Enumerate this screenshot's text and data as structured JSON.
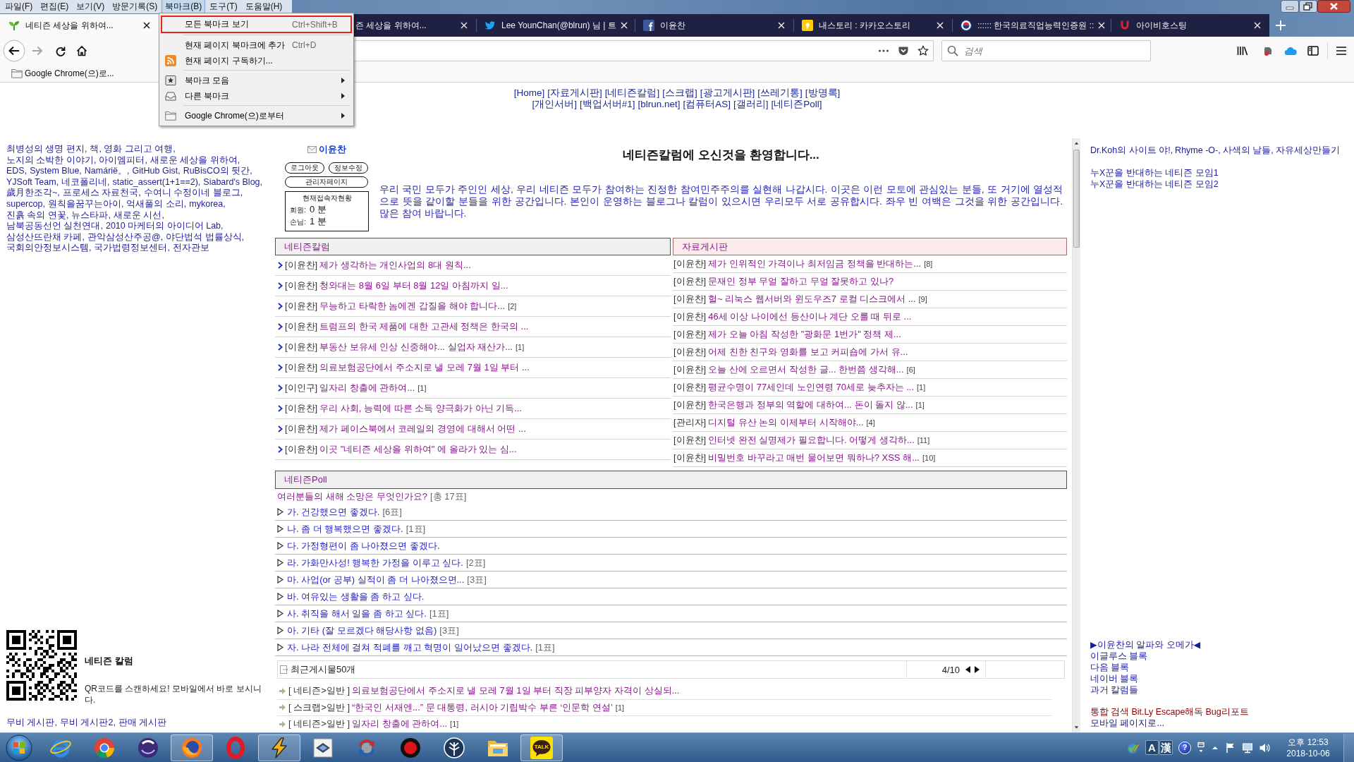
{
  "menu_bar": [
    {
      "label": "파일(F)",
      "selected": false
    },
    {
      "label": "편집(E)",
      "selected": false
    },
    {
      "label": "보기(V)",
      "selected": false
    },
    {
      "label": "방문기록(S)",
      "selected": false
    },
    {
      "label": "북마크(B)",
      "selected": true
    },
    {
      "label": "도구(T)",
      "selected": false
    },
    {
      "label": "도움말(H)",
      "selected": false
    }
  ],
  "tabs": [
    {
      "title": "네티즌 세상을 위하여...",
      "selected": true
    },
    {
      "title": "즌 세상을 위하여...",
      "selected": false
    },
    {
      "title": "Lee YounChan(@blrun) 님 | 트",
      "selected": false
    },
    {
      "title": "이윤찬",
      "selected": false
    },
    {
      "title": "내스토리 : 카카오스토리",
      "selected": false
    },
    {
      "title": ":::::: 한국의료직업능력인증원 ::",
      "selected": false
    },
    {
      "title": "아이비호스팅",
      "selected": false
    }
  ],
  "bookmarks_menu": [
    {
      "kind": "item",
      "label": "모든 북마크 보기",
      "shortcut": "Ctrl+Shift+B",
      "selected": true,
      "submenu": false
    },
    {
      "kind": "separator"
    },
    {
      "kind": "item",
      "label": "현재 페이지 북마크에 추가",
      "shortcut": "Ctrl+D",
      "selected": false,
      "submenu": false
    },
    {
      "kind": "item",
      "label": "현재 페이지 구독하기...",
      "selected": false,
      "submenu": false
    },
    {
      "kind": "separator"
    },
    {
      "kind": "item",
      "label": "북마크 모음",
      "selected": false,
      "submenu": true
    },
    {
      "kind": "item",
      "label": "다른 북마크",
      "selected": false,
      "submenu": true
    },
    {
      "kind": "separator"
    },
    {
      "kind": "item",
      "label": "Google Chrome(으)로부터",
      "selected": false,
      "submenu": true
    }
  ],
  "search": {
    "placeholder": "검색"
  },
  "bookmarks_toolbar": [
    "Google Chrome(으)로..."
  ],
  "page": {
    "top_link_rows": [
      [
        "[Home]",
        "[자료게시판]",
        "[네티즌칼럼]",
        "[스크랩]",
        "[광고게시판]",
        "[쓰레기통]",
        "[방명록]"
      ],
      [
        "[개인서버]",
        "[백업서버#1]",
        "[blrun.net]",
        "[컴퓨터AS]",
        "[갤러리]",
        "[네티즌Poll]"
      ]
    ],
    "left_sidebar": {
      "blog_links": [
        "최병성의 생명 편지,",
        "책, 영화 그리고 여행,",
        "노지의 소박한 이야기,",
        "아이엠피터,",
        "새로운 세상을 위하여,",
        "EDS,",
        "System Blue,",
        "Namárië。,",
        "GitHub Gist,",
        "RuBisCO의 뒷간,",
        "YJSoft Team,",
        "네코폴리네,",
        "static_assert(1+1==2),",
        "Siabard's Blog,",
        "歲月한조각~,",
        "프로세스 자료천국,",
        "수여니 수정이네 블로그,",
        "supercop,",
        "원칙을꿈꾸는아이,",
        "억새풀의 소리,",
        "mykorea,",
        "진흙 속의 연꽃,",
        "뉴스타파,",
        "새로운 시선,",
        "남북공동선언 실천연대,",
        "2010 마케터의 아이디어 Lab,",
        "삼성산뜨란채 카페,",
        "관악삼성산주공@,",
        "야단법석 법률상식,",
        "국회의안정보시스템,",
        "국가법령정보센터,",
        "전자관보"
      ],
      "qr_title": "네티즌 칼럼",
      "qr_caption": "QR코드를 스캔하세요! 모바일에서 바로 보시니다.",
      "board_links": [
        "무비 게시판,",
        "무비 게시판2,",
        "판매 게시판"
      ]
    },
    "user_panel": {
      "name": "이윤찬",
      "buttons": [
        "로그아웃",
        "정보수정",
        "관리자페이지"
      ],
      "visitors_title": "현재접속자현황",
      "visitors": [
        {
          "label": "회원:",
          "count": "0 분"
        },
        {
          "label": "손님:",
          "count": "1 분"
        }
      ]
    },
    "welcome": {
      "title": "네티즌칼럼에 오신것을 환영합니다...",
      "text": "우리 국민 모두가 주인인 세상, 우리 네티즌 모두가 참여하는 진정한 참여민주주의를 실현해 나갑시다. 이곳은 이런 모토에 관심있는 분들, 또 거기에 열성적으로 뜻을 같이할 분들을 위한 공간입니다. 본인이 운영하는 블로그나 칼럼이 있으시면 우리모두 서로 공유합시다. 좌우 빈 여백은 그것을 위한 공간입니다. 많은 참여 바랍니다."
    },
    "boards": [
      {
        "kind": "column",
        "title": "네티즌칼럼",
        "posts": [
          {
            "author": "[이윤찬]",
            "title": "제가 생각하는 개인사업의 8대 원칙..."
          },
          {
            "author": "[이윤찬]",
            "title": "청와대는 8월 6일 부터 8월 12일 아침까지 일..."
          },
          {
            "author": "[이윤찬]",
            "title": "무능하고 타락한 놈에겐 갑질을 해야 합니다...",
            "comments": "[2]"
          },
          {
            "author": "[이윤찬]",
            "title": "트럼프의 한국 제품에 대한 고관세 정책은 한국의 ..."
          },
          {
            "author": "[이윤찬]",
            "title": "부동산 보유세 인상 신중해야... 실업자 재산가...",
            "comments": "[1]"
          },
          {
            "author": "[이윤찬]",
            "title": "의료보험공단에서 주소지로 낼 모레 7월 1일 부터 ..."
          },
          {
            "author": "[이인구]",
            "title": "일자리 창출에 관하여...",
            "comments": "[1]"
          },
          {
            "author": "[이윤찬]",
            "title": "우리 사회, 능력에 따른 소득 양극화가 아닌 기득..."
          },
          {
            "author": "[이윤찬]",
            "title": "제가 페이스북에서 코레일의 경영에 대해서 어떤 ..."
          },
          {
            "author": "[이윤찬]",
            "title": "이곳 \"네티즌 세상을 위하여\" 에 올라가 있는 심..."
          }
        ]
      },
      {
        "kind": "archive",
        "title": "자료게시판",
        "posts": [
          {
            "author": "[이윤찬]",
            "title": "제가 인위적인 가격이나 최저임금 정책을 반대하는...",
            "comments": "[8]"
          },
          {
            "author": "[이윤찬]",
            "title": "문재인 정부 무얼 잘하고 무얼 잘못하고 있나?"
          },
          {
            "author": "[이윤찬]",
            "title": "헐~ 리눅스 웹서버와 윈도우즈7 로컬 디스크에서 ...",
            "comments": "[9]"
          },
          {
            "author": "[이윤찬]",
            "title": "46세 이상 나이에선 등산이나 계단 오를 때 뒤로 ..."
          },
          {
            "author": "[이윤찬]",
            "title": "제가 오늘 아침 작성한 \"광화문 1번가\" 정책 제..."
          },
          {
            "author": "[이윤찬]",
            "title": "어제 친한 친구와 영화를 보고 커피숍에 가서 유..."
          },
          {
            "author": "[이윤찬]",
            "title": "오늘 산에 오르면서 작성한 글... 한번쯤 생각해...",
            "comments": "[6]"
          },
          {
            "author": "[이윤찬]",
            "title": "평균수명이 77세인데 노인연령 70세로 늦추자는 ...",
            "comments": "[1]"
          },
          {
            "author": "[이윤찬]",
            "title": "한국은행과 정부의 역할에 대하여... 돈이 돌지 않...",
            "comments": "[1]"
          },
          {
            "author": "[관리자]",
            "title": "디지털 유산 논의 이제부터 시작해야...",
            "comments": "[4]"
          },
          {
            "author": "[이윤찬]",
            "title": "인터넷 완전 실명제가 필요합니다. 어떻게 생각하...",
            "comments": "[11]"
          },
          {
            "author": "[이윤찬]",
            "title": "비밀번호 바꾸라고 매번 물어보면 뭐하나? XSS 해...",
            "comments": "[10]"
          }
        ]
      }
    ],
    "poll": {
      "title": "네티즌Poll",
      "question": "여러분들의 새해 소망은 무엇인가요?",
      "total": "[총 17표]",
      "options": [
        {
          "text": "가. 건강했으면 좋겠다.",
          "votes": "[6표]"
        },
        {
          "text": "나. 좀 더 행복했으면 좋겠다.",
          "votes": "[1표]"
        },
        {
          "text": "다. 가정형편이 좀 나아졌으면 좋겠다."
        },
        {
          "text": "라. 가화만사성! 행복한 가정을 이루고 싶다.",
          "votes": "[2표]"
        },
        {
          "text": "마. 사업(or 공부) 실적이 좀 더 나아졌으면...",
          "votes": "[3표]"
        },
        {
          "text": "바. 여유있는 생활을 좀 하고 싶다."
        },
        {
          "text": "사. 취직을 해서 일을 좀 하고 싶다.",
          "votes": "[1표]"
        },
        {
          "text": "아. 기타 (잘 모르겠다 해당사항 없음)",
          "votes": "[3표]"
        },
        {
          "text": "자. 나라 전체에 걸쳐 적폐를 깨고 혁명이 일어났으면 좋겠다.",
          "votes": "[1표]"
        }
      ]
    },
    "recent": {
      "title": "최근게시물50개",
      "pager": "4/10",
      "posts": [
        {
          "category": "[ 네티즌>일반 ]",
          "title": "의료보험공단에서 주소지로 낼 모레 7월 1일 부터 직장 피부양자 자격이 상실되..."
        },
        {
          "category": "[ 스크랩>일반 ]",
          "title": "“한국인 서재엔...” 문 대통령, 러시아 기립박수 부른 ‘인문학 연설’",
          "comments": "[1]"
        },
        {
          "category": "[ 네티즌>일반 ]",
          "title": "일자리 창출에 관하여...",
          "comments": "[1]"
        }
      ]
    },
    "right_sidebar": {
      "site_links": [
        "Dr.Koh의 사이트 야!,",
        "Rhyme -O-,",
        "사색의 날들,",
        "자유세상만들기"
      ],
      "group_links": [
        "누X꾼을 반대하는 네티즌 모임1",
        "누X꾼을 반대하는 네티즌 모임2"
      ],
      "blog_links": [
        "▶이윤찬의 알파와 오메가◀",
        "이글루스 블록",
        "다음 블록",
        "네이버 블록",
        "과거 칼럼들"
      ],
      "tool_links": [
        "통합 검색",
        "Bit.Ly Escape해독",
        "Bug리포트"
      ],
      "mobile_link": "모바일 페이지로..."
    }
  },
  "taskbar": {
    "apps": [
      {
        "running": false
      },
      {
        "running": false
      },
      {
        "running": false
      },
      {
        "running": true
      },
      {
        "running": false
      },
      {
        "running": true
      },
      {
        "running": false
      },
      {
        "running": false
      },
      {
        "running": false
      },
      {
        "running": false
      },
      {
        "running": false
      },
      {
        "running": true,
        "label": "TALK"
      }
    ],
    "input_indicators": [
      "A",
      "漢"
    ],
    "help_mark": "?",
    "clock": {
      "time": "오후 12:53",
      "date": "2018-10-06"
    }
  }
}
